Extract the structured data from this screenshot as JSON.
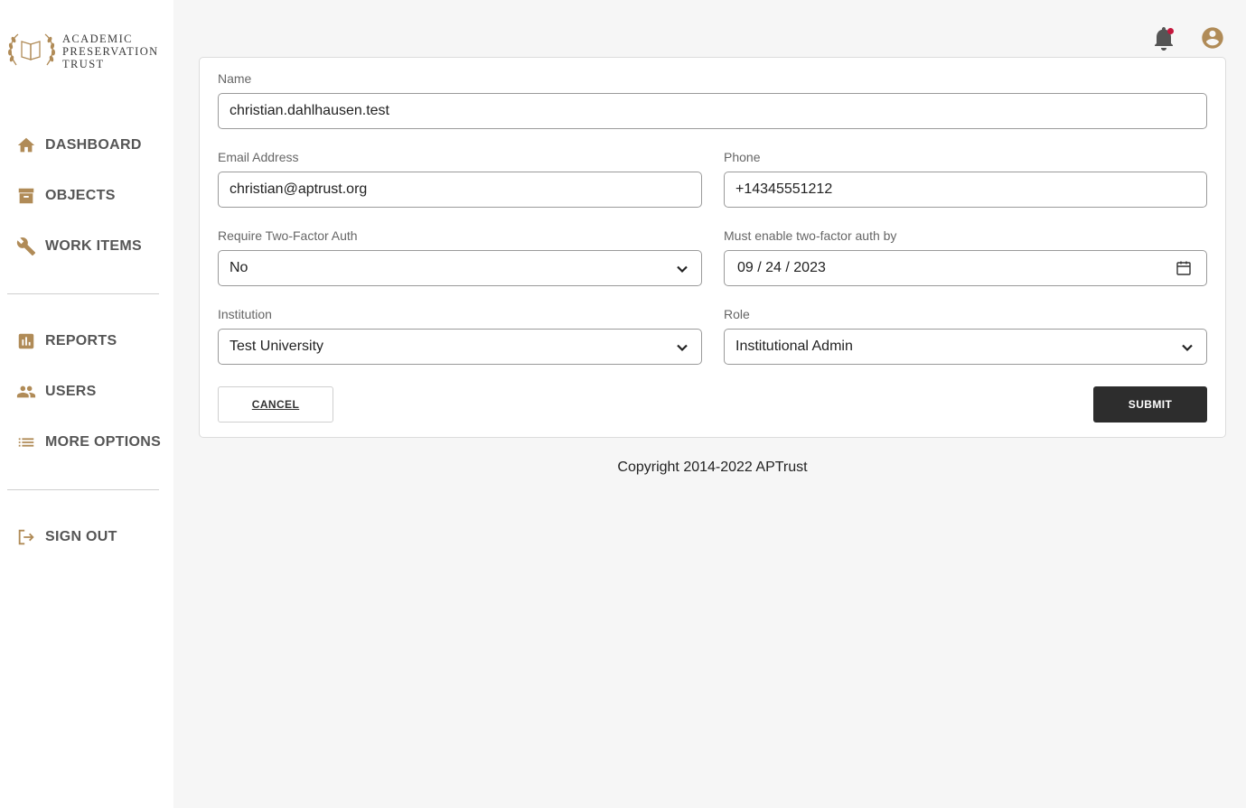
{
  "brand": {
    "line1": "ACADEMIC",
    "line2": "PRESERVATION",
    "line3": "TRUST",
    "logo_icon": "laurel-book-icon",
    "accent_color": "#b08b57"
  },
  "sidebar": {
    "primary": [
      {
        "label": "DASHBOARD",
        "icon": "home-icon"
      },
      {
        "label": "OBJECTS",
        "icon": "archive-icon"
      },
      {
        "label": "WORK ITEMS",
        "icon": "wrench-icon"
      }
    ],
    "secondary": [
      {
        "label": "REPORTS",
        "icon": "bar-chart-icon"
      },
      {
        "label": "USERS",
        "icon": "people-icon"
      },
      {
        "label": "MORE OPTIONS",
        "icon": "list-icon"
      }
    ],
    "signout": {
      "label": "SIGN OUT",
      "icon": "sign-out-icon"
    }
  },
  "header": {
    "notification_icon": "bell-icon",
    "account_icon": "account-circle-icon"
  },
  "form": {
    "name": {
      "label": "Name",
      "value": "christian.dahlhausen.test"
    },
    "email": {
      "label": "Email Address",
      "value": "christian@aptrust.org"
    },
    "phone": {
      "label": "Phone",
      "value": "+14345551212"
    },
    "two_factor": {
      "label": "Require Two-Factor Auth",
      "value": "No"
    },
    "two_factor_deadline": {
      "label": "Must enable two-factor auth by",
      "value": "09 / 24 / 2023"
    },
    "institution": {
      "label": "Institution",
      "value": "Test University"
    },
    "role": {
      "label": "Role",
      "value": "Institutional Admin"
    },
    "cancel_label": "CANCEL",
    "submit_label": "SUBMIT"
  },
  "footer": {
    "copyright": "Copyright 2014-2022 APTrust"
  }
}
